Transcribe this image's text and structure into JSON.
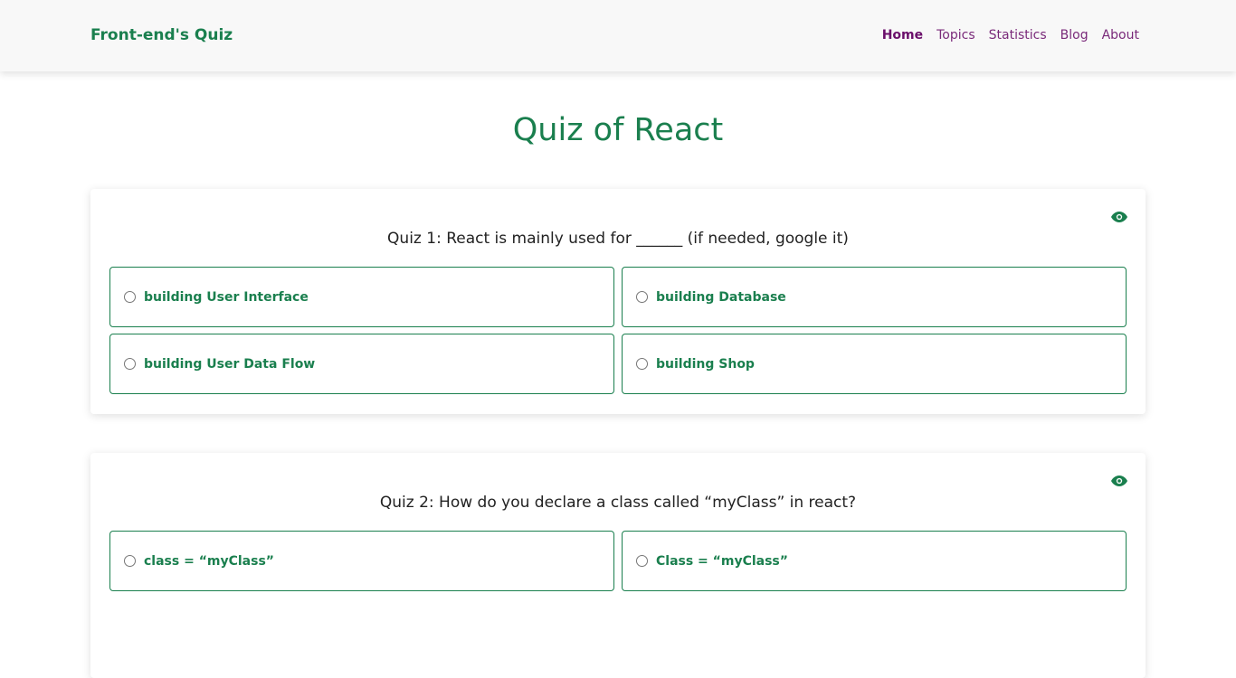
{
  "nav": {
    "brand": "Front-end's Quiz",
    "links": [
      {
        "label": "Home",
        "active": true
      },
      {
        "label": "Topics"
      },
      {
        "label": "Statistics"
      },
      {
        "label": "Blog"
      },
      {
        "label": "About"
      }
    ]
  },
  "page_title": "Quiz of React",
  "accent_color": "#1a7f4e",
  "nav_link_color": "#7a2a7a",
  "quizzes": [
    {
      "question": "Quiz 1: React is mainly used for ______ (if needed, google it)",
      "show_answer_icon": "eye-icon",
      "options": [
        "building User Interface",
        "building Database",
        "building User Data Flow",
        "building Shop"
      ]
    },
    {
      "question": "Quiz 2: How do you declare a class called “myClass” in react?",
      "show_answer_icon": "eye-icon",
      "options": [
        "class = “myClass”",
        "Class = “myClass”"
      ]
    }
  ]
}
